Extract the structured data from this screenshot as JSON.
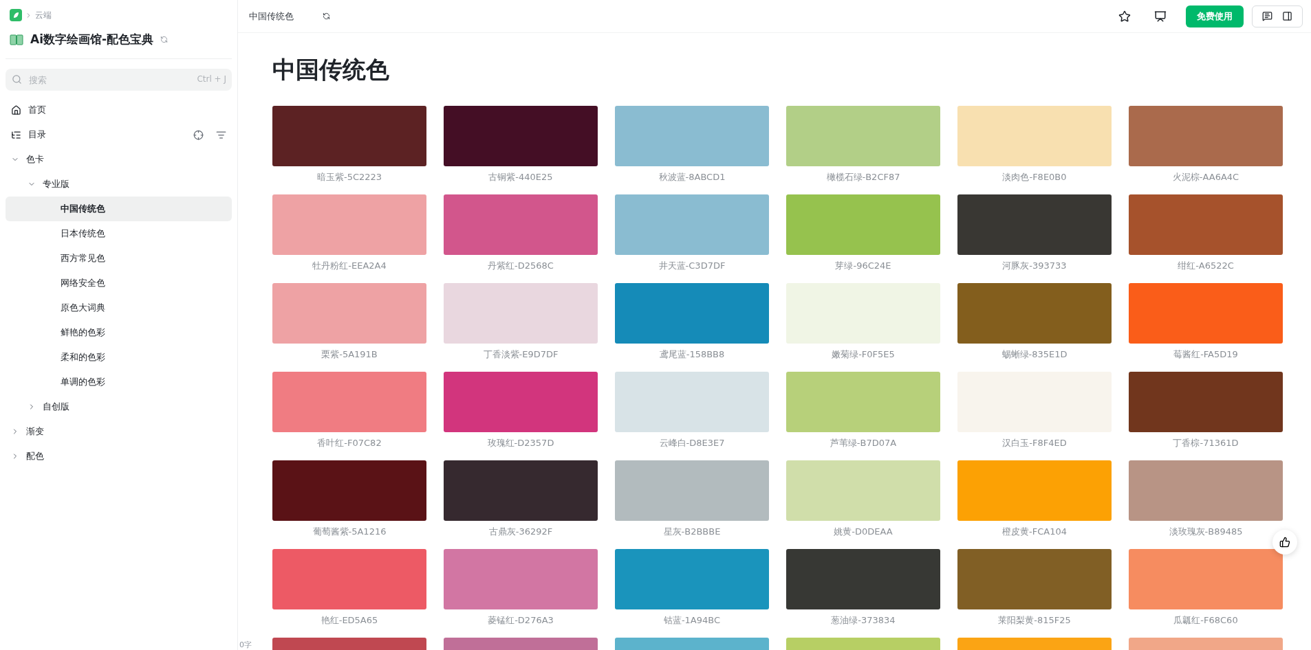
{
  "sidebar": {
    "breadcrumb": "云端",
    "title": "Ai数字绘画馆-配色宝典",
    "search": {
      "placeholder": "搜索",
      "shortcut": "Ctrl + J"
    },
    "nav": [
      {
        "kind": "home",
        "label": "首页"
      },
      {
        "kind": "toc",
        "label": "目录"
      }
    ],
    "tree": [
      {
        "label": "色卡",
        "expanded": true,
        "children": [
          {
            "label": "专业版",
            "expanded": true,
            "children": [
              {
                "label": "中国传统色",
                "selected": true
              },
              {
                "label": "日本传统色",
                "selected": false
              },
              {
                "label": "西方常见色",
                "selected": false
              },
              {
                "label": "网络安全色",
                "selected": false
              },
              {
                "label": "原色大词典",
                "selected": false
              },
              {
                "label": "鲜艳的色彩",
                "selected": false
              },
              {
                "label": "柔和的色彩",
                "selected": false
              },
              {
                "label": "单调的色彩",
                "selected": false
              }
            ]
          },
          {
            "label": "自创版",
            "expanded": false
          }
        ]
      },
      {
        "label": "渐变",
        "expanded": false
      },
      {
        "label": "配色",
        "expanded": false
      }
    ]
  },
  "topbar": {
    "doc_title": "中国传统色",
    "primary_button": "免费使用"
  },
  "page": {
    "heading": "中国传统色",
    "word_count": "0字",
    "swatches": [
      {
        "label": "暗玉紫-5C2223",
        "color": "#5c2223"
      },
      {
        "label": "古铜紫-440E25",
        "color": "#440e25"
      },
      {
        "label": "秋波蓝-8ABCD1",
        "color": "#8abcd1"
      },
      {
        "label": "橄榄石绿-B2CF87",
        "color": "#b2cf87"
      },
      {
        "label": "淡肉色-F8E0B0",
        "color": "#f8e0b0"
      },
      {
        "label": "火泥棕-AA6A4C",
        "color": "#aa6a4c"
      },
      {
        "label": "牡丹粉红-EEA2A4",
        "color": "#eea2a4"
      },
      {
        "label": "丹紫红-D2568C",
        "color": "#d2568c"
      },
      {
        "label": "井天蓝-C3D7DF",
        "color": "#8abcd1"
      },
      {
        "label": "芽绿-96C24E",
        "color": "#96c24e"
      },
      {
        "label": "河豚灰-393733",
        "color": "#393733"
      },
      {
        "label": "绀红-A6522C",
        "color": "#a6522c"
      },
      {
        "label": "栗紫-5A191B",
        "color": "#eea2a4"
      },
      {
        "label": "丁香淡紫-E9D7DF",
        "color": "#e9d7df"
      },
      {
        "label": "鸢尾蓝-158BB8",
        "color": "#158bb8"
      },
      {
        "label": "嫩菊绿-F0F5E5",
        "color": "#f0f5e5"
      },
      {
        "label": "蜴蜥绿-835E1D",
        "color": "#835e1d"
      },
      {
        "label": "莓酱红-FA5D19",
        "color": "#fa5d19"
      },
      {
        "label": "香叶红-F07C82",
        "color": "#f07c82"
      },
      {
        "label": "玫瑰红-D2357D",
        "color": "#d2357d"
      },
      {
        "label": "云峰白-D8E3E7",
        "color": "#d8e3e7"
      },
      {
        "label": "芦苇绿-B7D07A",
        "color": "#b7d07a"
      },
      {
        "label": "汉白玉-F8F4ED",
        "color": "#f8f4ed"
      },
      {
        "label": "丁香棕-71361D",
        "color": "#71361d"
      },
      {
        "label": "葡萄酱紫-5A1216",
        "color": "#5a1216"
      },
      {
        "label": "古鼎灰-36292F",
        "color": "#36292f"
      },
      {
        "label": "星灰-B2BBBE",
        "color": "#b2bbbe"
      },
      {
        "label": "姚黄-D0DEAA",
        "color": "#d0deaa"
      },
      {
        "label": "橙皮黄-FCA104",
        "color": "#fca104"
      },
      {
        "label": "淡玫瑰灰-B89485",
        "color": "#b89485"
      },
      {
        "label": "艳红-ED5A65",
        "color": "#ed5a65"
      },
      {
        "label": "菱锰红-D276A3",
        "color": "#d276a3"
      },
      {
        "label": "钴蓝-1A94BC",
        "color": "#1a94bc"
      },
      {
        "label": "葱油绿-373834",
        "color": "#373834"
      },
      {
        "label": "莱阳梨黄-815F25",
        "color": "#815f25"
      },
      {
        "label": "瓜瓤红-F68C60",
        "color": "#f68c60"
      },
      {
        "color": "#c04851"
      },
      {
        "color": "#c06f98"
      },
      {
        "color": "#5cb3cc"
      },
      {
        "color": "#b7cf64"
      },
      {
        "color": "#fba414"
      },
      {
        "color": "#f1a788"
      }
    ]
  }
}
